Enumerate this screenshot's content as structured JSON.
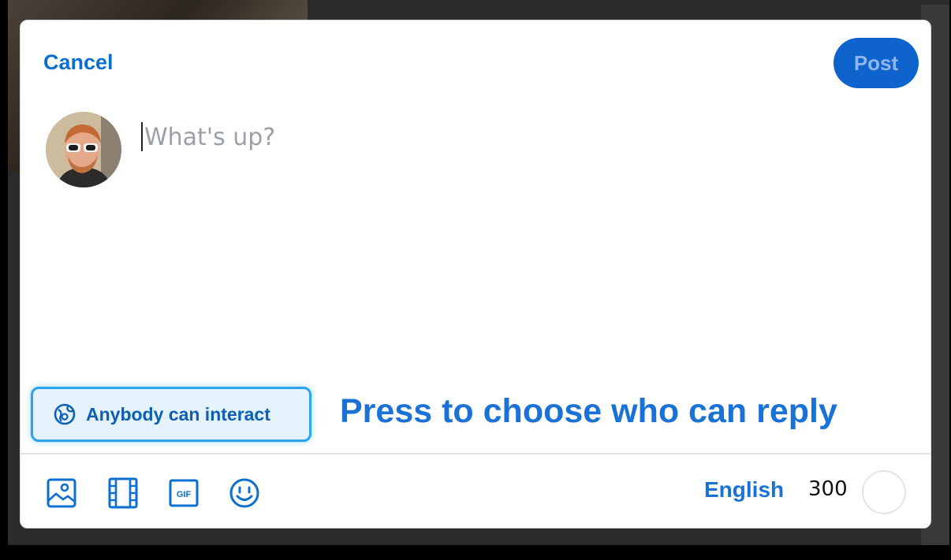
{
  "composer": {
    "cancel_label": "Cancel",
    "post_label": "Post",
    "placeholder": "What's up?",
    "text": ""
  },
  "interaction": {
    "button_label": "Anybody can interact",
    "icon": "globe-person-icon",
    "hint": "Press to choose who can reply"
  },
  "toolbar": {
    "icons": [
      "image-icon",
      "video-icon",
      "gif-icon",
      "emoji-icon"
    ],
    "gif_text": "GIF",
    "language": "English",
    "remaining_chars": "300",
    "progress": 0
  },
  "colors": {
    "accent": "#0a6fd1",
    "post_bg": "#0f63cc",
    "highlight_border": "#2aa3f0"
  }
}
